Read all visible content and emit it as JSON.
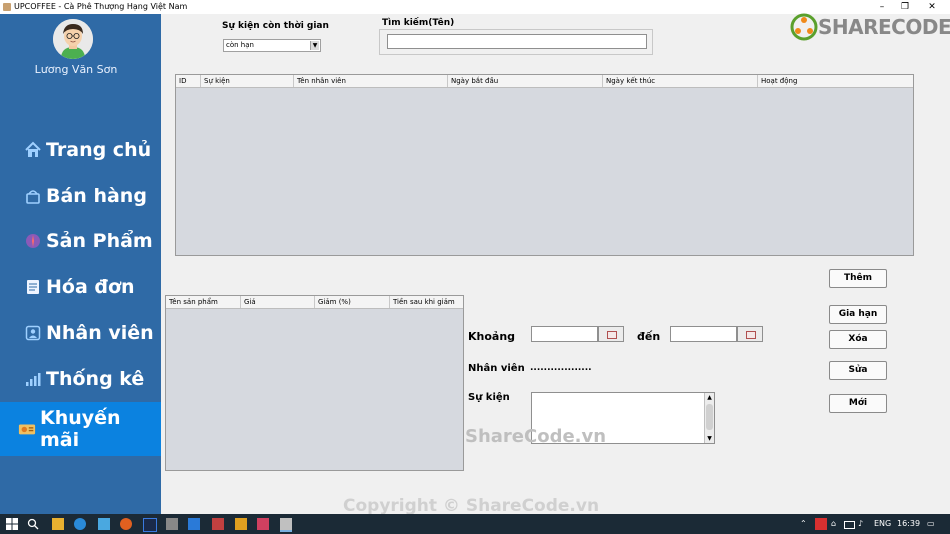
{
  "window": {
    "title": "UPCOFFEE - Cà Phê Thượng Hạng Việt Nam",
    "minimize": "–",
    "restore": "❐",
    "close": "✕"
  },
  "sidebar": {
    "user_name": "Lương Văn Sơn",
    "items": [
      {
        "label": "Trang chủ",
        "icon": "home-icon"
      },
      {
        "label": "Bán hàng",
        "icon": "basket-icon"
      },
      {
        "label": "Sản Phẩm",
        "icon": "product-icon"
      },
      {
        "label": "Hóa đơn",
        "icon": "invoice-icon"
      },
      {
        "label": "Nhân viên",
        "icon": "employee-icon"
      },
      {
        "label": "Thống kê",
        "icon": "stats-icon"
      },
      {
        "label": "Khuyến mãi",
        "icon": "promotion-icon",
        "active": true
      }
    ]
  },
  "filter": {
    "label": "Sự kiện còn thời gian",
    "selected": "còn hạn"
  },
  "search": {
    "label": "Tìm kiếm(Tên)",
    "value": ""
  },
  "events_table": {
    "columns": [
      "ID",
      "Sự kiện",
      "Tên nhân viên",
      "Ngày bắt đầu",
      "Ngày kết thúc",
      "Hoạt động"
    ],
    "rows": []
  },
  "products_table": {
    "columns": [
      "Tên sản phẩm",
      "Giá",
      "Giảm (%)",
      "Tiền sau khi giảm"
    ],
    "rows": []
  },
  "form": {
    "period_label": "Khoảng",
    "to_label": "đến",
    "employee_label": "Nhân viên",
    "employee_value": "..................",
    "event_label": "Sự kiện"
  },
  "buttons": {
    "add": "Thêm",
    "extend": "Gia hạn",
    "delete": "Xóa",
    "edit": "Sửa",
    "new": "Mới"
  },
  "watermarks": {
    "logo": "SHARECODE.vn",
    "center": "ShareCode.vn",
    "bottom": "Copyright © ShareCode.vn"
  },
  "taskbar": {
    "language": "ENG",
    "time": "16:39"
  },
  "colors": {
    "sidebar": "#2f6aa6",
    "active_item": "#0b82e0",
    "panel": "#f0f0f0",
    "table_body": "#d6d9df"
  }
}
